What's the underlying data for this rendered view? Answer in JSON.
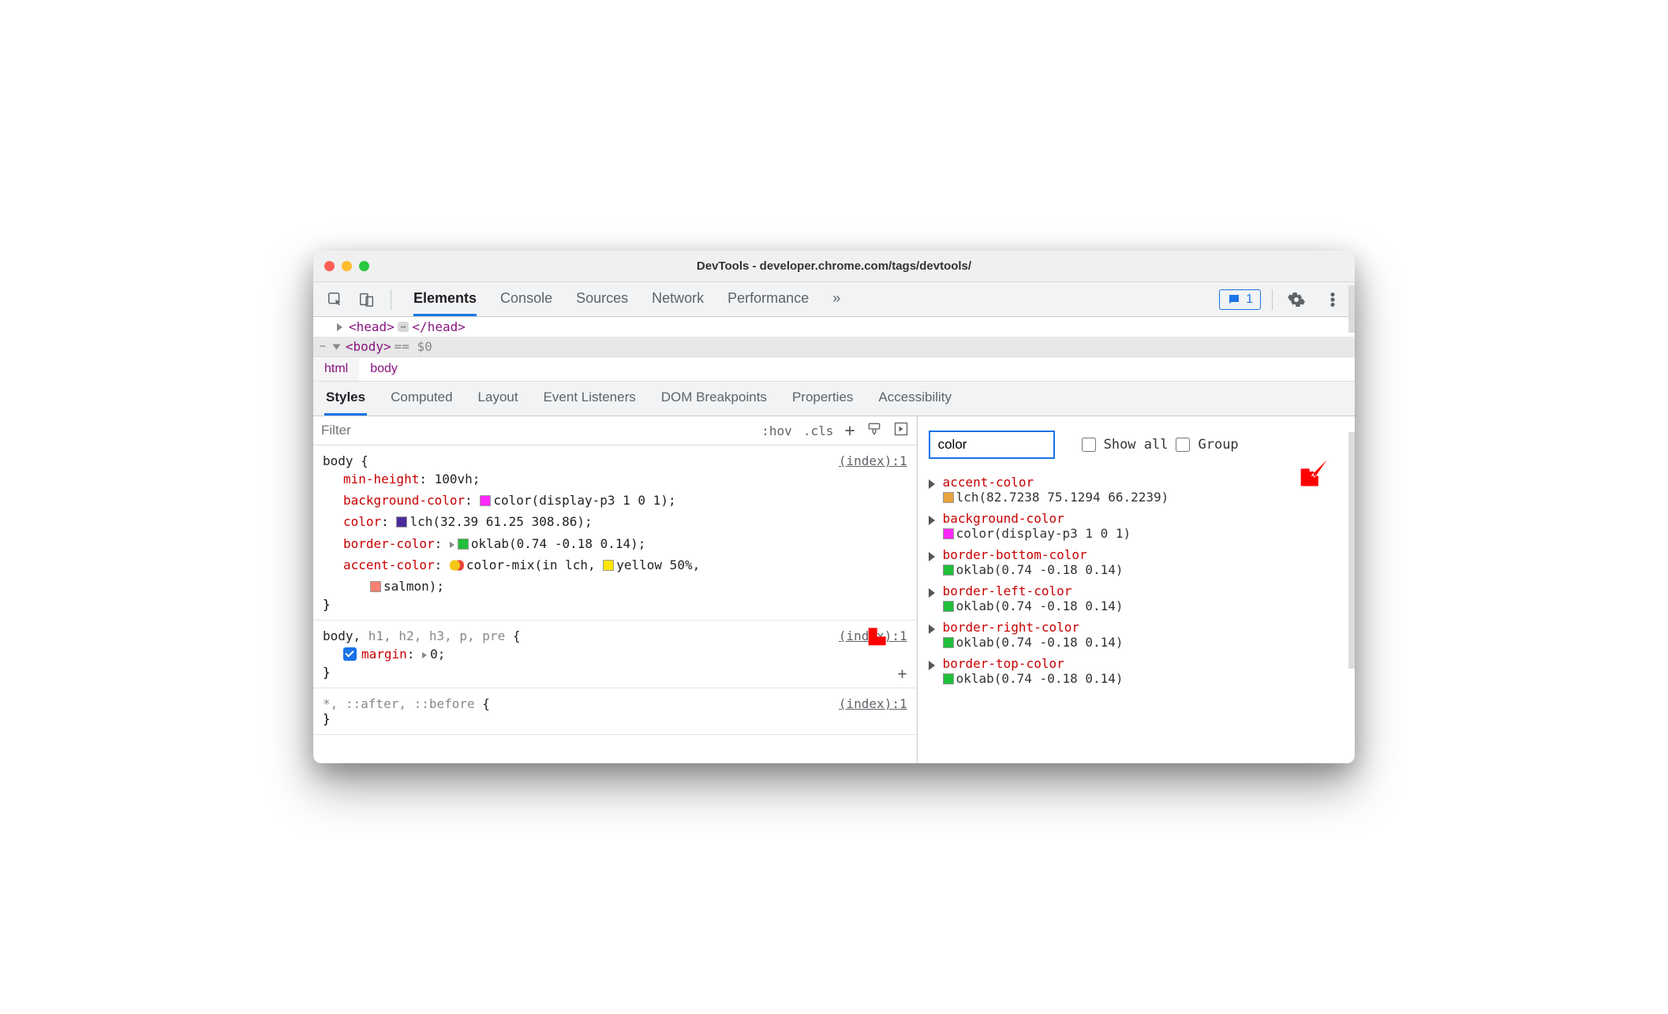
{
  "window_title": "DevTools - developer.chrome.com/tags/devtools/",
  "issues_count": "1",
  "main_tabs": [
    "Elements",
    "Console",
    "Sources",
    "Network",
    "Performance"
  ],
  "overflow_glyph": "»",
  "dom": {
    "head_open": "<head>",
    "head_close": "</head>",
    "body_open": "<body>",
    "eq": "== $0"
  },
  "breadcrumbs": [
    "html",
    "body"
  ],
  "sub_tabs": [
    "Styles",
    "Computed",
    "Layout",
    "Event Listeners",
    "DOM Breakpoints",
    "Properties",
    "Accessibility"
  ],
  "styles": {
    "filter_placeholder": "Filter",
    "hov": ":hov",
    "cls": ".cls",
    "rules": [
      {
        "selector_main": "body",
        "selector_dim": "",
        "source": "(index):1",
        "lines": [
          {
            "prop": "min-height",
            "val": "100vh",
            "swatch": null,
            "prefix": ""
          },
          {
            "prop": "background-color",
            "val": "color(display-p3 1 0 1)",
            "swatch": "#ff29ff",
            "prefix": ""
          },
          {
            "prop": "color",
            "val": "lch(32.39 61.25 308.86)",
            "swatch": "#4b2a9e",
            "prefix": ""
          },
          {
            "prop": "border-color",
            "val": "oklab(0.74 -0.18 0.14)",
            "swatch": "#1fbf3a",
            "prefix": "tri"
          },
          {
            "prop": "accent-color",
            "val": "color-mix(in lch, ",
            "swatch": "mix",
            "prefix": "",
            "tail": [
              {
                "sw": "#ffe600",
                "txt": "yellow 50%,"
              }
            ]
          },
          {
            "cont": true,
            "swatch": "#fa8072",
            "txt": "salmon);"
          }
        ]
      },
      {
        "selector_main": "body,",
        "selector_dim": " h1, h2, h3, p, pre",
        "source": "(index):1",
        "lines": [
          {
            "checked": true,
            "prop": "margin",
            "val": "0",
            "prefix": "tri"
          }
        ],
        "show_plus": true
      },
      {
        "selector_main": "",
        "selector_dim": "*, ::after, ::before",
        "source": "(index):1",
        "lines": []
      }
    ]
  },
  "computed": {
    "filter_value": "color",
    "show_all_label": "Show all",
    "group_label": "Group",
    "props": [
      {
        "name": "accent-color",
        "swatch": "#e6a23c",
        "val": "lch(82.7238 75.1294 66.2239)"
      },
      {
        "name": "background-color",
        "swatch": "#ff29ff",
        "val": "color(display-p3 1 0 1)"
      },
      {
        "name": "border-bottom-color",
        "swatch": "#1fbf3a",
        "val": "oklab(0.74 -0.18 0.14)"
      },
      {
        "name": "border-left-color",
        "swatch": "#1fbf3a",
        "val": "oklab(0.74 -0.18 0.14)"
      },
      {
        "name": "border-right-color",
        "swatch": "#1fbf3a",
        "val": "oklab(0.74 -0.18 0.14)"
      },
      {
        "name": "border-top-color",
        "swatch": "#1fbf3a",
        "val": "oklab(0.74 -0.18 0.14)"
      }
    ]
  }
}
